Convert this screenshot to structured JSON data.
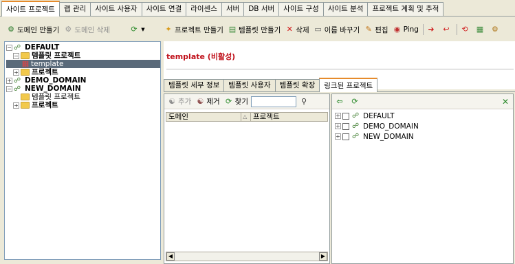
{
  "top_tabs": [
    "사이트 프로젝트",
    "랩 관리",
    "사이트 사용자",
    "사이트 연결",
    "라이센스",
    "서버",
    "DB 서버",
    "사이트 구성",
    "사이트 분석",
    "프로젝트 계획 및 추적"
  ],
  "left_toolbar": {
    "create_domain": "도메인 만들기",
    "delete_domain": "도메인 삭제"
  },
  "tree": [
    {
      "label": "DEFAULT",
      "level": 0,
      "type": "domain",
      "bold": true
    },
    {
      "label": "템플릿 프로젝트",
      "level": 1,
      "type": "folder",
      "bold": true
    },
    {
      "label": "template",
      "level": 2,
      "type": "project",
      "selected": true
    },
    {
      "label": "프로젝트",
      "level": 1,
      "type": "folder",
      "bold": true
    },
    {
      "label": "DEMO_DOMAIN",
      "level": 0,
      "type": "domain",
      "bold": true
    },
    {
      "label": "NEW_DOMAIN",
      "level": 0,
      "type": "domain",
      "bold": true
    },
    {
      "label": "템플릿 프로젝트",
      "level": 1,
      "type": "folder",
      "bold": false
    },
    {
      "label": "프로젝트",
      "level": 1,
      "type": "folder",
      "bold": true
    }
  ],
  "right_toolbar": {
    "create_project": "프로젝트 만들기",
    "create_template": "템플릿 만들기",
    "delete": "삭제",
    "rename": "이름 바꾸기",
    "edit": "편집",
    "ping": "Ping"
  },
  "header": {
    "title": "template (비활성)"
  },
  "sub_tabs": [
    "템플릿 세부 정보",
    "템플릿 사용자",
    "템플릿 확장",
    "링크된 프로젝트"
  ],
  "linked_pane": {
    "add": "추가",
    "remove": "제거",
    "find": "찾기",
    "search_value": "",
    "columns": [
      "도메인",
      "프로젝트"
    ]
  },
  "domains_pane": {
    "items": [
      "DEFAULT",
      "DEMO_DOMAIN",
      "NEW_DOMAIN"
    ]
  },
  "colors": {
    "accent_tab": "#e68b2c",
    "title_red": "#c0101a",
    "selected_bg": "#5a6a7a"
  }
}
